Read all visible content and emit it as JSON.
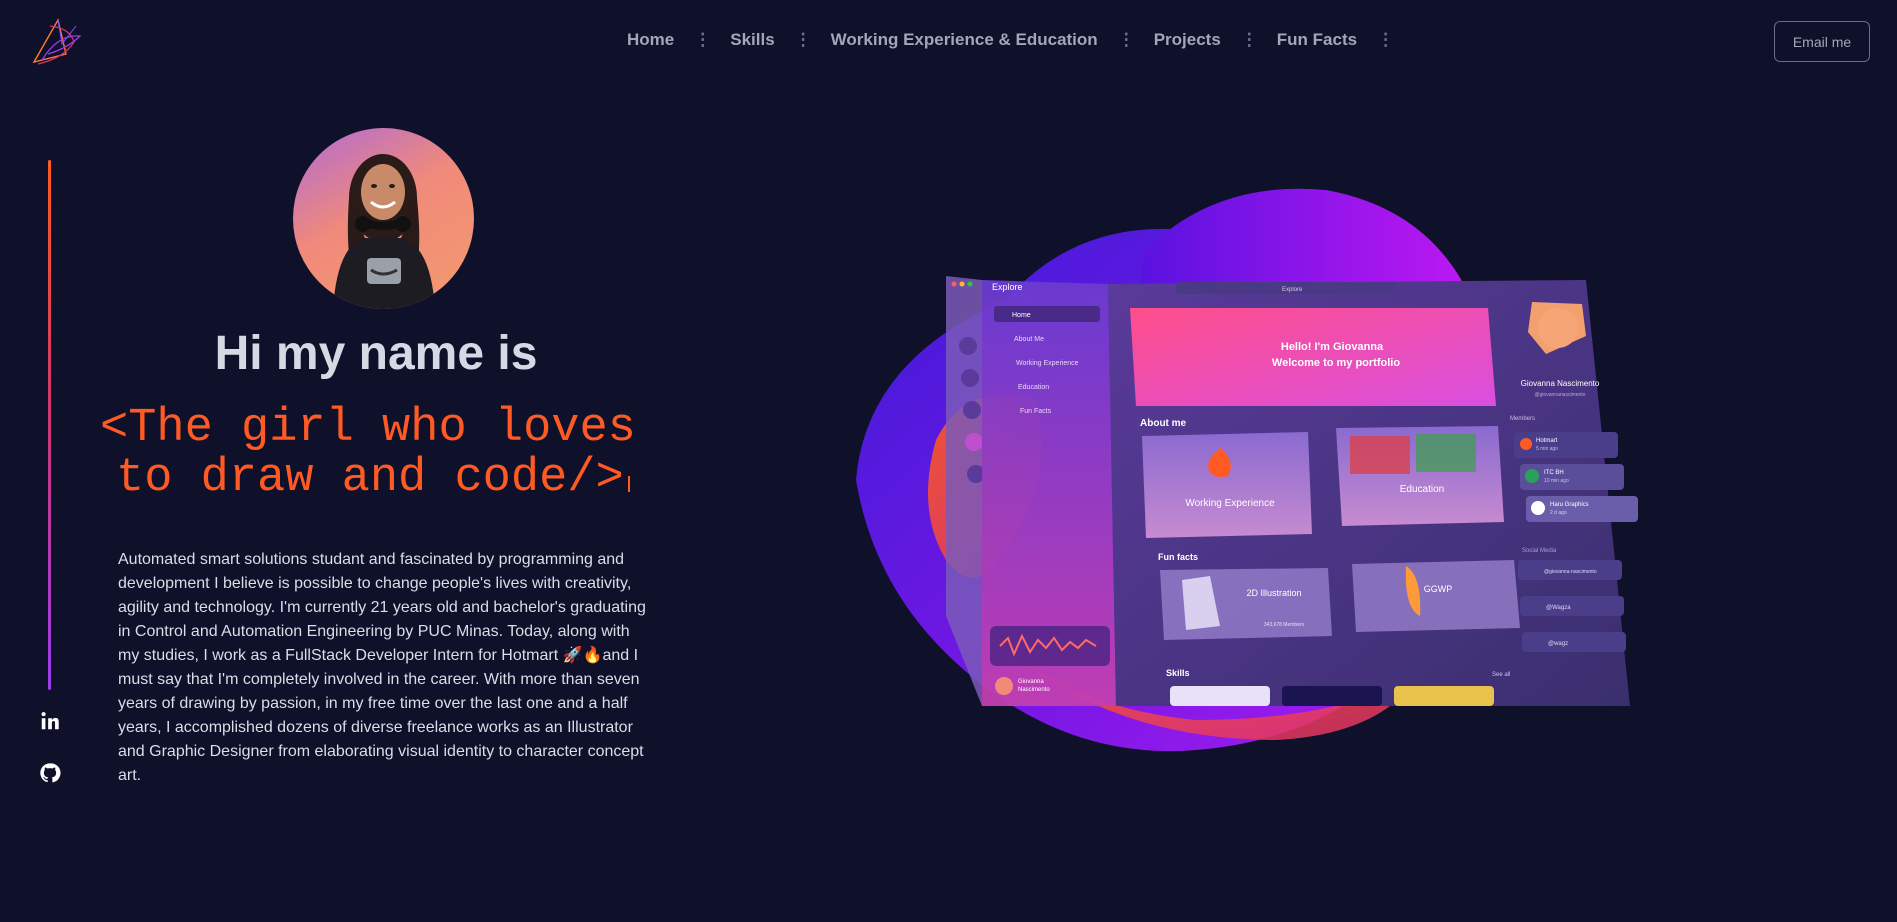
{
  "header": {
    "nav": [
      {
        "label": "Home"
      },
      {
        "label": "Skills"
      },
      {
        "label": "Working Experience & Education"
      },
      {
        "label": "Projects"
      },
      {
        "label": "Fun Facts"
      }
    ],
    "email_label": "Email me"
  },
  "hero": {
    "greeting": "Hi my name is",
    "tagline_line1": "<The girl who loves",
    "tagline_line2": "to draw and code/>",
    "bio": "Automated smart solutions studant and fascinated by programming and development I believe is possible to change people's lives with creativity, agility and technology. I'm currently 21 years old and bachelor's graduating in Control and Automation Engineering by PUC Minas. Today, along with my studies, I work as a FullStack Developer Intern for Hotmart 🚀🔥and I must say that I'm completely involved in the career. With more than seven years of drawing by passion, in my free time over the last one and a half years, I accomplished dozens of diverse freelance works as an Illustrator and Graphic Designer from elaborating visual identity to character concept art."
  },
  "social": [
    {
      "icon": "linkedin-icon"
    },
    {
      "icon": "github-icon"
    }
  ],
  "mockup": {
    "sidebar_title": "Explore",
    "search_placeholder": "Explore",
    "menu": [
      "Home",
      "About Me",
      "Working Experience",
      "Education",
      "Fun Facts"
    ],
    "banner_line1": "Hello! I'm Giovanna",
    "banner_line2": "Welcome to my portfolio",
    "about_heading": "About me",
    "card_work": "Working Experience",
    "card_education": "Education",
    "funfacts_heading": "Fun facts",
    "card_illustration": "2D Illustration",
    "card_ggwp": "GGWP",
    "members": "343,678 Members",
    "skills_heading": "Skills",
    "see_all": "See all",
    "profile_name": "Giovanna Nascimento",
    "profile_handle": "@giovannanascimento",
    "members_heading": "Members",
    "companies": [
      {
        "name": "Hotmart",
        "time": "5 min ago"
      },
      {
        "name": "ITC BH",
        "time": "10 min ago"
      },
      {
        "name": "Haru Graphics",
        "time": "2 d ago"
      }
    ],
    "social_heading": "Social Media",
    "social_links": [
      "@giovanna-nascimento",
      "@Wagza",
      "@wagz"
    ],
    "user_name": "Giovanna",
    "user_last": "Nascimento"
  },
  "colors": {
    "background": "#0f102a",
    "accent_orange": "#ff5a24",
    "accent_purple": "#9b3cf0",
    "nav_text": "#a3a6b8"
  }
}
